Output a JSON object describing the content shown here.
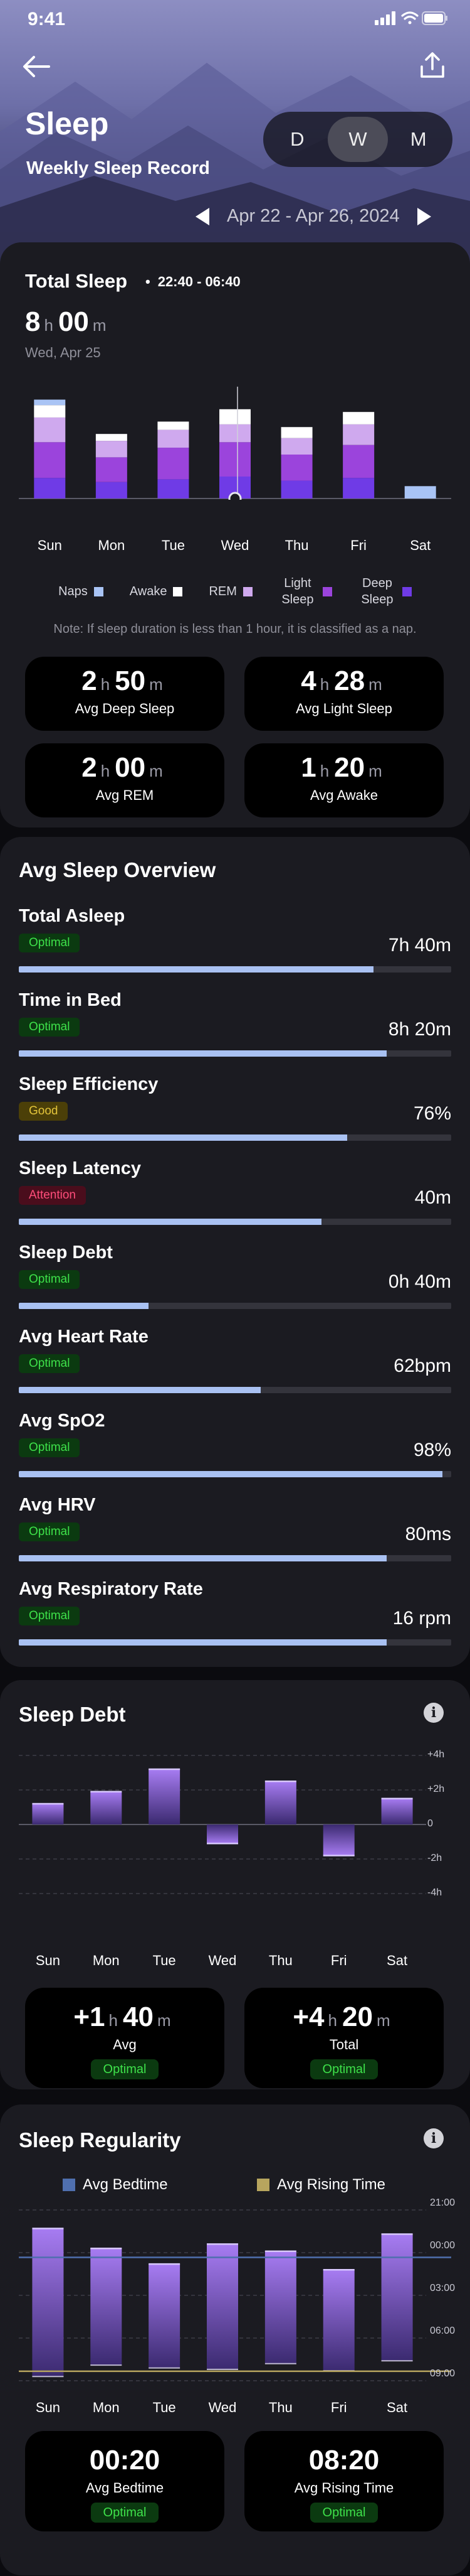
{
  "status_bar": {
    "time": "9:41"
  },
  "header": {
    "title": "Sleep",
    "subtitle": "Weekly Sleep Record",
    "segments": [
      "D",
      "W",
      "M"
    ],
    "active_segment": "W",
    "date_range": "Apr 22 - Apr 26, 2024"
  },
  "total_sleep": {
    "title": "Total Sleep",
    "time_range": "22:40 - 06:40",
    "hours": "8",
    "minutes": "00",
    "h_unit": "h",
    "m_unit": "m",
    "date": "Wed, Apr 25",
    "note": "Note: If sleep duration is less than 1 hour, it is classified as a nap.",
    "legend": [
      {
        "label": "Naps",
        "color": "#a9c4f5"
      },
      {
        "label": "Awake",
        "color": "#ffffff"
      },
      {
        "label": "REM",
        "color": "#cfa9ee"
      },
      {
        "label": "Light Sleep",
        "color": "#9b44dc"
      },
      {
        "label": "Deep Sleep",
        "color": "#6f3be6"
      }
    ],
    "stats": [
      {
        "h": "2",
        "m": "50",
        "label": "Avg Deep Sleep"
      },
      {
        "h": "4",
        "m": "28",
        "label": "Avg Light Sleep"
      },
      {
        "h": "2",
        "m": "00",
        "label": "Avg REM"
      },
      {
        "h": "1",
        "m": "20",
        "label": "Avg Awake"
      }
    ]
  },
  "chart_data": [
    {
      "type": "bar",
      "title": "Total Sleep",
      "stacked": true,
      "categories": [
        "Sun",
        "Mon",
        "Tue",
        "Wed",
        "Thu",
        "Fri",
        "Sat"
      ],
      "series": [
        {
          "name": "Deep Sleep",
          "color": "#6f3be6",
          "values": [
            1.5,
            1.2,
            1.4,
            1.6,
            1.3,
            1.5,
            0
          ]
        },
        {
          "name": "Light Sleep",
          "color": "#9b44dc",
          "values": [
            2.6,
            1.8,
            2.3,
            2.5,
            1.9,
            2.4,
            0
          ]
        },
        {
          "name": "REM",
          "color": "#cfa9ee",
          "values": [
            1.8,
            1.2,
            1.3,
            1.3,
            1.2,
            1.5,
            0
          ]
        },
        {
          "name": "Awake",
          "color": "#ffffff",
          "values": [
            0.9,
            0.5,
            0.6,
            1.1,
            0.8,
            0.9,
            0
          ]
        },
        {
          "name": "Naps",
          "color": "#a9c4f5",
          "values": [
            0.4,
            0,
            0,
            0,
            0,
            0,
            0.9
          ]
        }
      ],
      "selected": "Wed"
    },
    {
      "type": "bar",
      "title": "Sleep Debt",
      "categories": [
        "Sun",
        "Mon",
        "Tue",
        "Wed",
        "Thu",
        "Fri",
        "Sat"
      ],
      "values": [
        1.2,
        1.9,
        3.2,
        -1.1,
        2.5,
        -1.8,
        1.5
      ],
      "y_ticks": [
        "+4h",
        "+2h",
        "0",
        "-2h",
        "-4h"
      ],
      "ylim": [
        -4,
        4
      ]
    },
    {
      "type": "bar",
      "title": "Sleep Regularity",
      "categories": [
        "Sun",
        "Mon",
        "Tue",
        "Wed",
        "Thu",
        "Fri",
        "Sat"
      ],
      "legend": [
        {
          "label": "Avg Bedtime",
          "color": "#4f6fae"
        },
        {
          "label": "Avg Rising Time",
          "color": "#b7a55e"
        }
      ],
      "y_ticks": [
        "21:00",
        "00:00",
        "03:00",
        "06:00",
        "09:00"
      ],
      "ylim_hours": [
        21,
        33
      ],
      "bed_hours": [
        22.3,
        23.7,
        24.8,
        23.4,
        23.9,
        25.2,
        22.7
      ],
      "wake_hours": [
        32.7,
        31.9,
        32.1,
        32.2,
        31.8,
        32.3,
        31.6
      ],
      "avg_bed_hour": 24.33,
      "avg_rise_hour": 32.33
    }
  ],
  "overview": {
    "title": "Avg Sleep Overview",
    "metrics": [
      {
        "label": "Total Asleep",
        "badge": "Optimal",
        "tone": "good",
        "value": "7h 40m",
        "fraction": 0.82
      },
      {
        "label": "Time in Bed",
        "badge": "Optimal",
        "tone": "good",
        "value": "8h 20m",
        "fraction": 0.85
      },
      {
        "label": "Sleep Efficiency",
        "badge": "Good",
        "tone": "ok",
        "value": "76%",
        "fraction": 0.76
      },
      {
        "label": "Sleep Latency",
        "badge": "Attention",
        "tone": "bad",
        "value": "40m",
        "fraction": 0.7
      },
      {
        "label": "Sleep Debt",
        "badge": "Optimal",
        "tone": "good",
        "value": "0h 40m",
        "fraction": 0.3
      },
      {
        "label": "Avg Heart Rate",
        "badge": "Optimal",
        "tone": "good",
        "value": "62bpm",
        "fraction": 0.56
      },
      {
        "label": "Avg SpO2",
        "badge": "Optimal",
        "tone": "good",
        "value": "98%",
        "fraction": 0.98
      },
      {
        "label": "Avg HRV",
        "badge": "Optimal",
        "tone": "good",
        "value": "80ms",
        "fraction": 0.85
      },
      {
        "label": "Avg Respiratory Rate",
        "badge": "Optimal",
        "tone": "good",
        "value": "16 rpm",
        "fraction": 0.85
      }
    ]
  },
  "debt": {
    "title": "Sleep Debt",
    "stats": [
      {
        "sign": "+1",
        "h_unit": "h",
        "m": "40",
        "m_unit": "m",
        "label": "Avg",
        "badge": "Optimal"
      },
      {
        "sign": "+4",
        "h_unit": "h",
        "m": "20",
        "m_unit": "m",
        "label": "Total",
        "badge": "Optimal"
      }
    ]
  },
  "regularity": {
    "title": "Sleep Regularity",
    "stats": [
      {
        "value": "00:20",
        "label": "Avg Bedtime",
        "badge": "Optimal"
      },
      {
        "value": "08:20",
        "label": "Avg Rising Time",
        "badge": "Optimal"
      }
    ]
  },
  "colors": {
    "good_bg": "#0b3a10",
    "good_fg": "#3ee24a",
    "ok_bg": "#4b3f08",
    "ok_fg": "#e3c43a",
    "bad_bg": "#4a0d1c",
    "bad_fg": "#ff4d7a"
  }
}
